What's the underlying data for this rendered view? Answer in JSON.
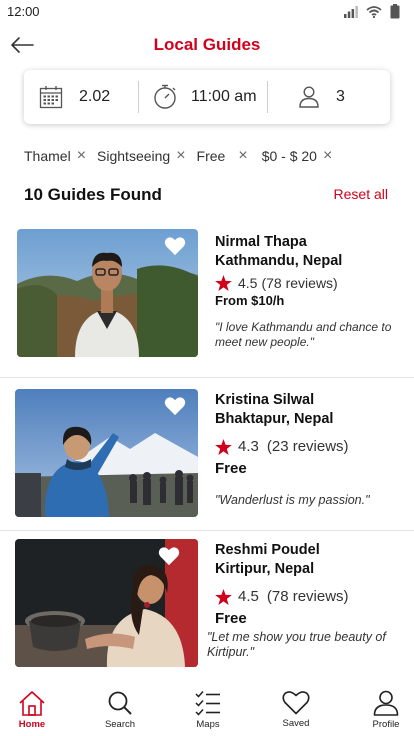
{
  "status": {
    "time": "12:00"
  },
  "header": {
    "title": "Local Guides"
  },
  "search": {
    "date": "2.02",
    "time": "11:00 am",
    "guests": "3"
  },
  "filters": [
    {
      "label": "Thamel"
    },
    {
      "label": "Sightseeing"
    },
    {
      "label": "Free"
    },
    {
      "label": "$0 - $ 20"
    }
  ],
  "results": {
    "count_label": "10 Guides Found",
    "reset_label": "Reset all"
  },
  "guides": [
    {
      "name": "Nirmal Thapa",
      "location": "Kathmandu, Nepal",
      "rating": "4.5",
      "reviews": "(78 reviews)",
      "price": "From $10/h",
      "quote": "\"I love Kathmandu and chance to meet new people.\""
    },
    {
      "name": "Kristina Silwal",
      "location": "Bhaktapur, Nepal",
      "rating": "4.3",
      "reviews": "(23 reviews)",
      "price": "Free",
      "quote": "\"Wanderlust is my passion.\""
    },
    {
      "name": "Reshmi Poudel",
      "location": "Kirtipur, Nepal",
      "rating": "4.5",
      "reviews": "(78 reviews)",
      "price": "Free",
      "quote": "\"Let me show you  true beauty of Kirtipur.\""
    }
  ],
  "colors": {
    "accent": "#d0021b",
    "star": "#d0021b"
  },
  "tabs": [
    {
      "label": "Home",
      "icon": "home-icon",
      "active": true
    },
    {
      "label": "Search",
      "icon": "search-icon"
    },
    {
      "label": "Maps",
      "icon": "checklist-icon"
    },
    {
      "label": "Saved",
      "icon": "heart-icon"
    },
    {
      "label": "Profile",
      "icon": "user-icon"
    }
  ]
}
